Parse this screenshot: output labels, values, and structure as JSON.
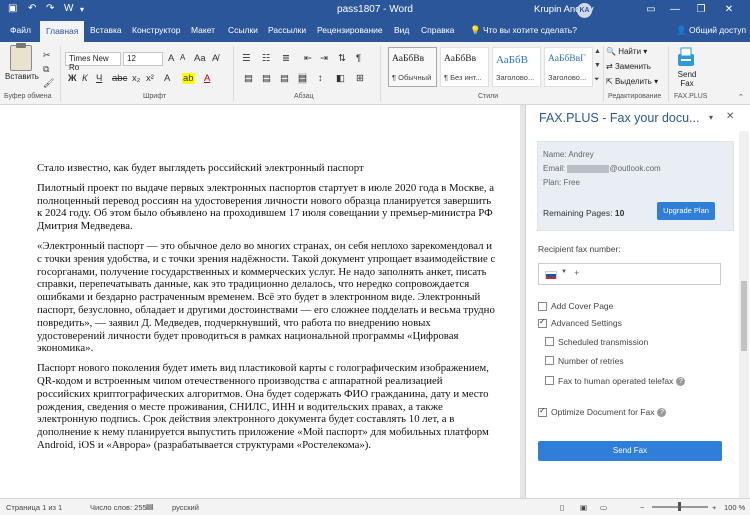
{
  "titlebar": {
    "title": "pass1807  -  Word",
    "user": "Krupin Andrey",
    "initials": "KA"
  },
  "tabs": [
    "Файл",
    "Главная",
    "Вставка",
    "Конструктор",
    "Макет",
    "Ссылки",
    "Рассылки",
    "Рецензирование",
    "Вид",
    "Справка"
  ],
  "tell_me": "Что вы хотите сделать?",
  "share": "Общий доступ",
  "ribbon": {
    "clipboard": {
      "paste": "Вставить",
      "label": "Буфер обмена"
    },
    "font": {
      "name": "Times New Ro",
      "size": "12",
      "label": "Шрифт"
    },
    "paragraph": {
      "label": "Абзац"
    },
    "styles": {
      "items": [
        {
          "sample": "АаБбВв",
          "name": "¶ Обычный"
        },
        {
          "sample": "АаБбВв",
          "name": "¶ Без инт..."
        },
        {
          "sample": "АаБбВ",
          "name": "Заголово..."
        },
        {
          "sample": "АаБбВвГ",
          "name": "Заголово..."
        }
      ],
      "label": "Стили"
    },
    "editing": {
      "find": "Найти",
      "replace": "Заменить",
      "select": "Выделить",
      "label": "Редактирование"
    },
    "faxplus": {
      "send": "Send Fax",
      "label": "FAX.PLUS"
    }
  },
  "document": {
    "paragraphs": [
      "Стало известно, как будет выглядеть российский электронный паспорт",
      "Пилотный проект по выдаче первых электронных паспортов стартует в июле 2020 года в Москве, а полноценный перевод россиян на удостоверения личности нового образца планируется завершить к 2024 году. Об этом было объявлено на проходившем 17 июля совещании у премьер-министра РФ Дмитрия Медведева.",
      "«Электронный паспорт — это обычное дело во многих странах, он себя неплохо зарекомендовал и с точки зрения удобства, и с точки зрения надёжности. Такой документ упрощает взаимодействие с госорганами, получение государственных и коммерческих услуг. Не надо заполнять анкет, писать справки, перепечатывать данные, как это традиционно делалось, что нередко сопровождается ошибками и бездарно растраченным временем. Всё это будет в электронном виде. Электронный паспорт, безусловно, обладает и другими достоинствами — его сложнее подделать и весьма трудно повредить», — заявил Д. Медведев, подчеркнувший, что работа по внедрению новых удостоверений личности будет проводиться в рамках национальной программы «Цифровая экономика».",
      "Паспорт нового поколения будет иметь вид пластиковой карты с голографическим изображением, QR-кодом и встроенным чипом отечественного производства с аппаратной реализацией российских криптографических алгоритмов. Она будет содержать ФИО гражданина, дату и место рождения, сведения о месте проживания, СНИЛС, ИНН и водительских правах, а также электронную подпись. Срок действия электронного документа будет составлять 10 лет, а в дополнение к нему планируется выпустить приложение «Мой паспорт» для мобильных платформ Android, iOS и «Аврора» (разрабатывается структурами «Ростелекома»)."
    ]
  },
  "pane": {
    "title": "FAX.PLUS - Fax your docu...",
    "name_line": "Name: Andrey",
    "email_prefix": "Email:",
    "email_suffix": "@outlook.com",
    "plan_line": "Plan: Free",
    "remaining_label": "Remaining Pages:",
    "remaining_value": "10",
    "upgrade": "Upgrade Plan",
    "recipient_label": "Recipient fax number:",
    "plus": "+",
    "options": {
      "cover": "Add Cover Page",
      "advanced": "Advanced Settings",
      "scheduled": "Scheduled transmission",
      "retries": "Number of retries",
      "human": "Fax to human operated telefax",
      "optimize": "Optimize Document for Fax"
    },
    "send": "Send Fax",
    "colors": {
      "accent": "#2f7ed8",
      "title": "#2b579a"
    }
  },
  "statusbar": {
    "page": "Страница 1 из 1",
    "words": "Число слов: 255",
    "language": "русский",
    "zoom": "100 %"
  }
}
